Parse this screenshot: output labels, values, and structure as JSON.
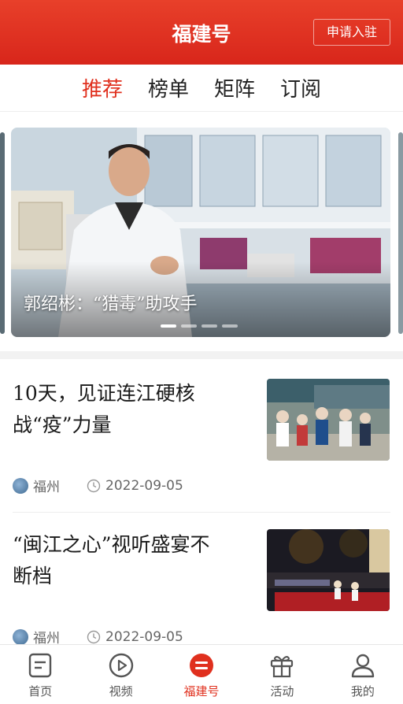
{
  "header": {
    "title": "福建号",
    "apply_label": "申请入驻"
  },
  "tabs": [
    {
      "label": "推荐",
      "active": true
    },
    {
      "label": "榜单",
      "active": false
    },
    {
      "label": "矩阵",
      "active": false
    },
    {
      "label": "订阅",
      "active": false
    }
  ],
  "carousel": {
    "caption": "郭绍彬：“猎毒”助攻手",
    "slide_count": 4,
    "active_index": 0
  },
  "news": [
    {
      "title_line1": "10天，见证连江硬核",
      "title_line2": "战“疫”力量",
      "source": "福州",
      "date": "2022-09-05"
    },
    {
      "title_line1": "“闽江之心”视听盛宴不",
      "title_line2": "断档",
      "source": "福州",
      "date": "2022-09-05"
    }
  ],
  "bottom_nav": [
    {
      "label": "首页",
      "icon": "home-doc-icon",
      "active": false
    },
    {
      "label": "视频",
      "icon": "play-icon",
      "active": false
    },
    {
      "label": "福建号",
      "icon": "fujian-hao-icon",
      "active": true
    },
    {
      "label": "活动",
      "icon": "gift-icon",
      "active": false
    },
    {
      "label": "我的",
      "icon": "user-icon",
      "active": false
    }
  ],
  "colors": {
    "brand_red": "#e0301e",
    "header_gradient_top": "#e8402a",
    "header_gradient_bottom": "#d8261b"
  }
}
